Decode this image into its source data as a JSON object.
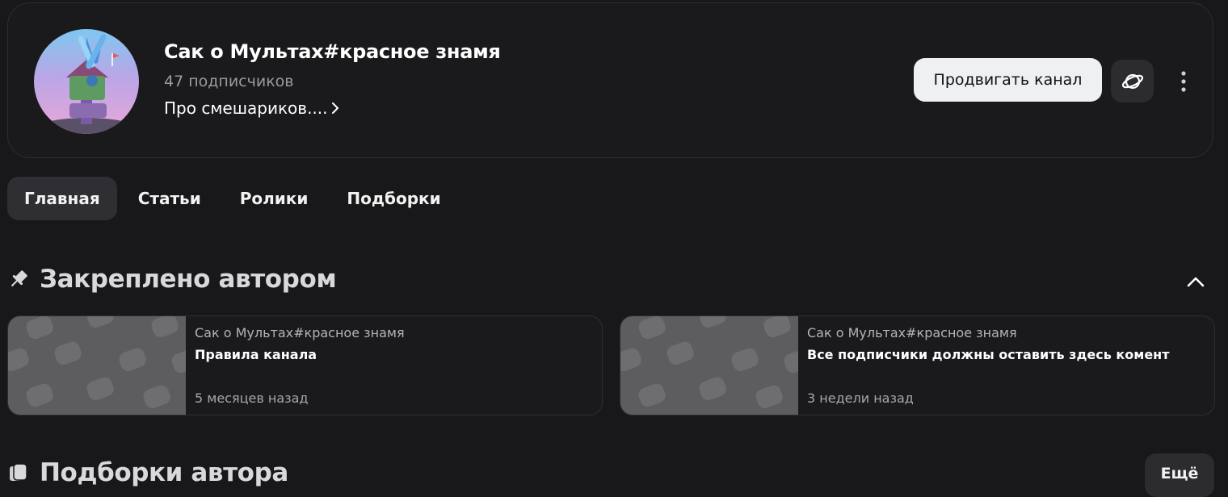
{
  "channel": {
    "name": "Сак о Мультах#красное знамя",
    "subscribers": "47 подписчиков",
    "description": "Про смешариков....",
    "promote_label": "Продвигать канал"
  },
  "tabs": [
    {
      "label": "Главная",
      "active": true
    },
    {
      "label": "Статьи",
      "active": false
    },
    {
      "label": "Ролики",
      "active": false
    },
    {
      "label": "Подборки",
      "active": false
    }
  ],
  "pinned": {
    "title": "Закреплено автором",
    "items": [
      {
        "author": "Сак о Мультах#красное знамя",
        "title": "Правила канала",
        "date": "5 месяцев назад"
      },
      {
        "author": "Сак о Мультах#красное знамя",
        "title": "Все подписчики должны оставить здесь комент",
        "date": "3 недели назад"
      }
    ]
  },
  "collections": {
    "title": "Подборки автора",
    "more_label": "Ещё"
  },
  "icons": {
    "pin": "pin-icon",
    "planet": "planet-icon",
    "more": "more-vertical-icon",
    "collapse": "chevron-up-icon",
    "chevron": "chevron-right-icon",
    "collection": "collection-icon"
  },
  "colors": {
    "background": "#18181a",
    "card_border": "#2e2e31",
    "primary_button": "#eff0f2",
    "secondary_button": "#2c2c2f",
    "active_tab": "#2f2f33",
    "thumb": "#5d5d60"
  }
}
